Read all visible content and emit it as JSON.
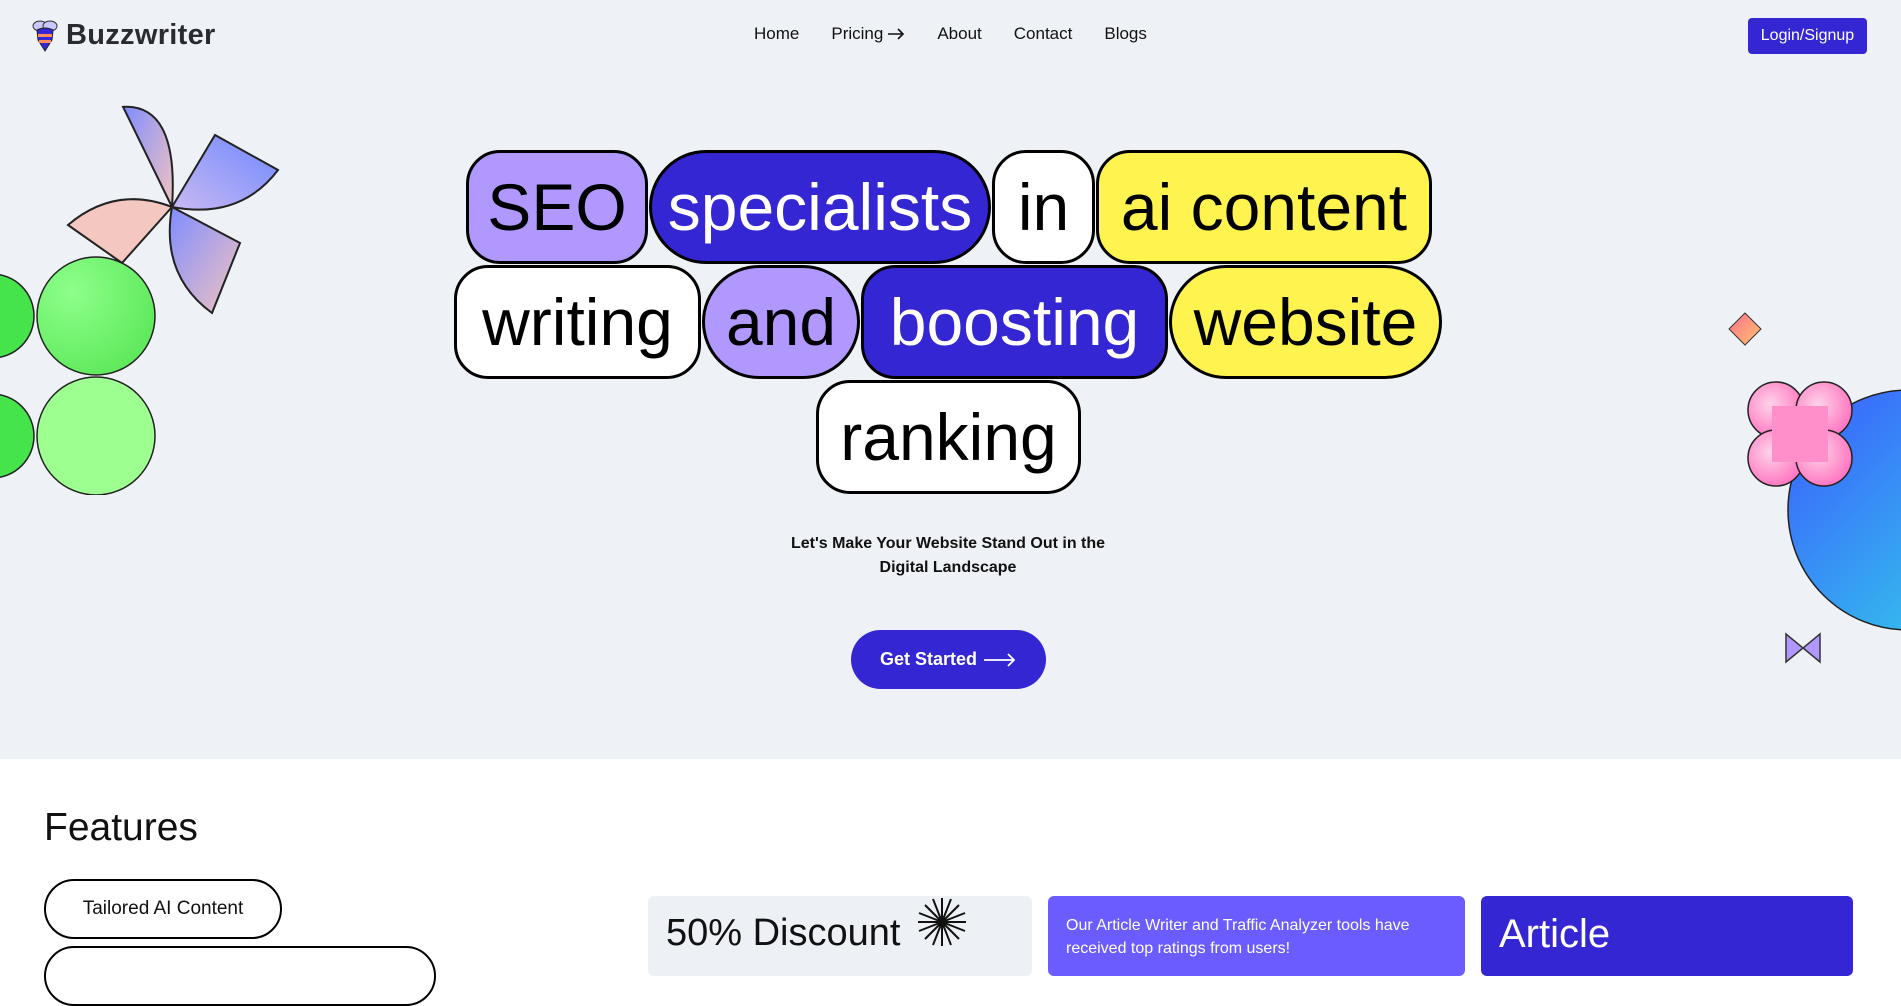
{
  "brand": {
    "name": "Buzzwriter",
    "logo_icon": "bee-icon"
  },
  "nav": {
    "items": [
      {
        "label": "Home"
      },
      {
        "label": "Pricing",
        "icon": "arrow-right-icon"
      },
      {
        "label": "About"
      },
      {
        "label": "Contact"
      },
      {
        "label": "Blogs"
      }
    ],
    "login_label": "Login/Signup"
  },
  "hero": {
    "words": [
      "SEO",
      "specialists",
      "in",
      "ai content",
      "writing",
      "and",
      "boosting",
      "website",
      "ranking"
    ],
    "subtitle": "Let's Make Your Website Stand Out in the Digital Landscape",
    "cta_label": "Get Started"
  },
  "features": {
    "title": "Features",
    "tabs": [
      {
        "label": "Tailored AI Content"
      }
    ],
    "cards": [
      {
        "title": "50% Discount"
      },
      {
        "text": "Our Article Writer and Traffic Analyzer tools have received top ratings from users!"
      },
      {
        "title": "Article"
      }
    ]
  },
  "colors": {
    "accent_blue": "#3426d2",
    "pill_purple": "#b198ff",
    "pill_yellow": "#fff350",
    "card_violet": "#6b5cff",
    "hero_bg": "#eef2f7"
  }
}
